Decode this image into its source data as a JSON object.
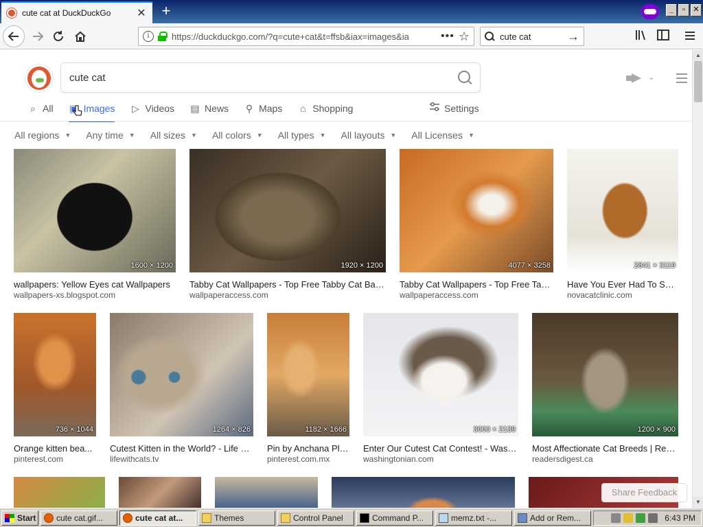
{
  "browser": {
    "tab_title": "cute cat at DuckDuckGo",
    "tab_close": "✕",
    "new_tab": "+",
    "url": "https://duckduckgo.com/?q=cute+cat&t=ffsb&iax=images&ia",
    "url_more": "•••",
    "search_value": "cute cat",
    "window_buttons": [
      "_",
      "▫",
      "✕"
    ]
  },
  "ddg": {
    "query": "cute cat",
    "tabs": [
      {
        "label": "All",
        "icon": "search-icon",
        "glyph": "⌕"
      },
      {
        "label": "Images",
        "icon": "image-icon",
        "glyph": "▣"
      },
      {
        "label": "Videos",
        "icon": "play-icon",
        "glyph": "▷"
      },
      {
        "label": "News",
        "icon": "newspaper-icon",
        "glyph": "▤"
      },
      {
        "label": "Maps",
        "icon": "map-pin-icon",
        "glyph": "⚲"
      },
      {
        "label": "Shopping",
        "icon": "shopping-bag-icon",
        "glyph": "⌂"
      }
    ],
    "settings_label": "Settings",
    "filters": [
      "All regions",
      "Any time",
      "All sizes",
      "All colors",
      "All types",
      "All layouts",
      "All Licenses"
    ],
    "feedback": "Share Feedback",
    "accent": "#3969ef"
  },
  "results": [
    {
      "caption": "wallpapers: Yellow Eyes cat Wallpapers",
      "source": "wallpapers-xs.blogspot.com",
      "dims": "1600 × 1200"
    },
    {
      "caption": "Tabby Cat Wallpapers - Top Free Tabby Cat Bac...",
      "source": "wallpaperaccess.com",
      "dims": "1920 × 1200"
    },
    {
      "caption": "Tabby Cat Wallpapers - Top Free Tab...",
      "source": "wallpaperaccess.com",
      "dims": "4077 × 3258"
    },
    {
      "caption": "Have You Ever Had To Say...",
      "source": "novacatclinic.com",
      "dims": "2841 × 3119"
    },
    {
      "caption": "Orange kitten bea...",
      "source": "pinterest.com",
      "dims": "736 × 1044"
    },
    {
      "caption": "Cutest Kitten in the World? - Life Wi...",
      "source": "lifewithcats.tv",
      "dims": "1264 × 826"
    },
    {
      "caption": "Pin by Anchana Plo...",
      "source": "pinterest.com.mx",
      "dims": "1182 × 1666"
    },
    {
      "caption": "Enter Our Cutest Cat Contest! - Washi...",
      "source": "washingtonian.com",
      "dims": "3000 × 2139"
    },
    {
      "caption": "Most Affectionate Cat Breeds | Rea...",
      "source": "readersdigest.ca",
      "dims": "1200 × 900"
    }
  ],
  "taskbar": {
    "start": "Start",
    "tasks": [
      "cute cat.gif...",
      "cute cat at...",
      "Themes",
      "Control Panel",
      "Command P...",
      "memz.txt -...",
      "Add or Rem..."
    ],
    "clock": "6:43 PM"
  }
}
